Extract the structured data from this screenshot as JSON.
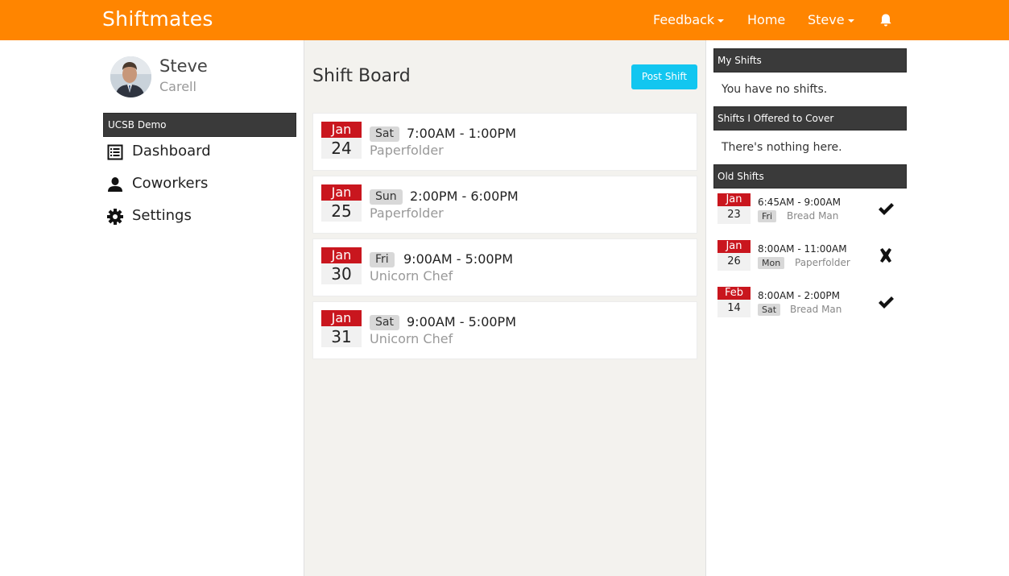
{
  "nav": {
    "brand": "Shiftmates",
    "feedback": "Feedback",
    "home": "Home",
    "user": "Steve",
    "bell_icon": "bell-icon"
  },
  "profile": {
    "first_name": "Steve",
    "last_name": "Carell",
    "org": "UCSB Demo"
  },
  "sidebar": {
    "items": [
      {
        "label": "Dashboard",
        "icon": "list-icon"
      },
      {
        "label": "Coworkers",
        "icon": "user-icon"
      },
      {
        "label": "Settings",
        "icon": "gear-icon"
      }
    ]
  },
  "board": {
    "title": "Shift Board",
    "post_button": "Post Shift",
    "shifts": [
      {
        "month": "Jan",
        "day": "24",
        "dow": "Sat",
        "time": "7:00AM - 1:00PM",
        "role": "Paperfolder"
      },
      {
        "month": "Jan",
        "day": "25",
        "dow": "Sun",
        "time": "2:00PM - 6:00PM",
        "role": "Paperfolder"
      },
      {
        "month": "Jan",
        "day": "30",
        "dow": "Fri",
        "time": "9:00AM - 5:00PM",
        "role": "Unicorn Chef"
      },
      {
        "month": "Jan",
        "day": "31",
        "dow": "Sat",
        "time": "9:00AM - 5:00PM",
        "role": "Unicorn Chef"
      }
    ]
  },
  "right": {
    "my_shifts_title": "My Shifts",
    "my_shifts_empty": "You have no shifts.",
    "offered_title": "Shifts I Offered to Cover",
    "offered_empty": "There's nothing here.",
    "old_title": "Old Shifts",
    "old_shifts": [
      {
        "month": "Jan",
        "day": "23",
        "time": "6:45AM - 9:00AM",
        "dow": "Fri",
        "role": "Bread Man",
        "status": "check-icon"
      },
      {
        "month": "Jan",
        "day": "26",
        "time": "8:00AM - 11:00AM",
        "dow": "Mon",
        "role": "Paperfolder",
        "status": "x-icon"
      },
      {
        "month": "Feb",
        "day": "14",
        "time": "8:00AM - 2:00PM",
        "dow": "Sat",
        "role": "Bread Man",
        "status": "check-icon"
      }
    ]
  },
  "colors": {
    "navbar": "#ff8500",
    "date_red": "#c9161e",
    "post_button": "#12c6f0",
    "section_header": "#3a3a3a"
  }
}
